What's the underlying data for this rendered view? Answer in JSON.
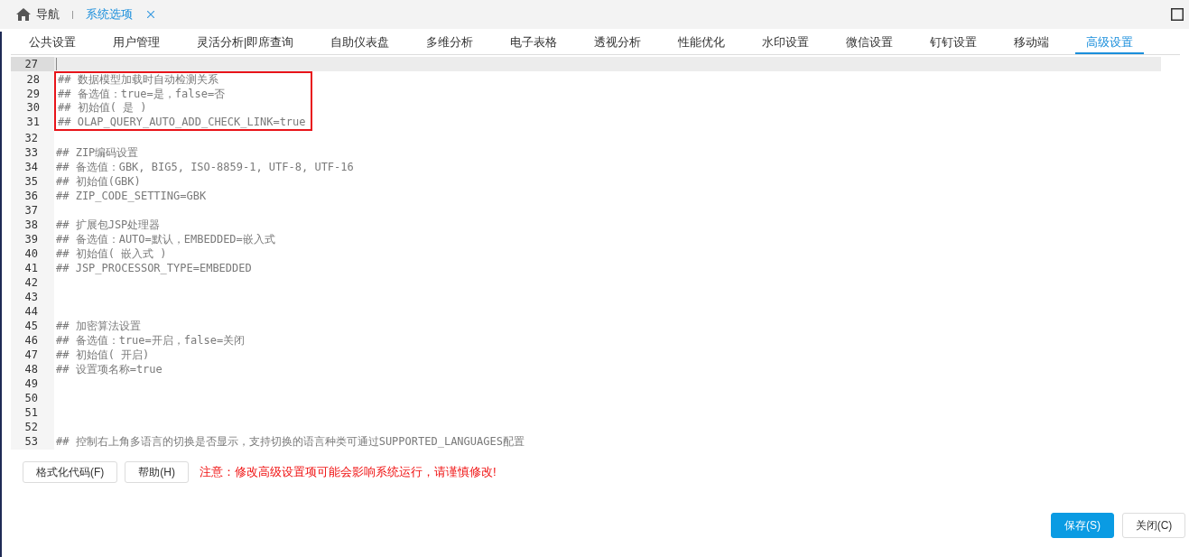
{
  "nav": {
    "home_label": "导航",
    "tabs": [
      {
        "label": "系统选项",
        "selected": true,
        "closable": true
      }
    ]
  },
  "settings_tabs": [
    {
      "label": "公共设置",
      "selected": false
    },
    {
      "label": "用户管理",
      "selected": false
    },
    {
      "label": "灵活分析|即席查询",
      "selected": false
    },
    {
      "label": "自助仪表盘",
      "selected": false
    },
    {
      "label": "多维分析",
      "selected": false
    },
    {
      "label": "电子表格",
      "selected": false
    },
    {
      "label": "透视分析",
      "selected": false
    },
    {
      "label": "性能优化",
      "selected": false
    },
    {
      "label": "水印设置",
      "selected": false
    },
    {
      "label": "微信设置",
      "selected": false
    },
    {
      "label": "钉钉设置",
      "selected": false
    },
    {
      "label": "移动端",
      "selected": false
    },
    {
      "label": "高级设置",
      "selected": true
    }
  ],
  "editor": {
    "lines": [
      {
        "number": "27",
        "current": true,
        "boxed": false
      },
      {
        "number": "28",
        "text": "## 数据模型加载时自动检测关系",
        "current": false,
        "boxed": true
      },
      {
        "number": "29",
        "text": "## 备选值：true=是，false=否",
        "current": false,
        "boxed": true
      },
      {
        "number": "30",
        "text": "## 初始值( 是 )",
        "current": false,
        "boxed": true
      },
      {
        "number": "31",
        "text": "## OLAP_QUERY_AUTO_ADD_CHECK_LINK=true",
        "current": false,
        "boxed": true
      },
      {
        "number": "32",
        "current": false,
        "boxed": false
      },
      {
        "number": "33",
        "text": "## ZIP编码设置",
        "current": false,
        "boxed": false
      },
      {
        "number": "34",
        "text": "## 备选值：GBK, BIG5, ISO-8859-1, UTF-8, UTF-16",
        "current": false,
        "boxed": false
      },
      {
        "number": "35",
        "text": "## 初始值(GBK)",
        "current": false,
        "boxed": false
      },
      {
        "number": "36",
        "text": "## ZIP_CODE_SETTING=GBK",
        "current": false,
        "boxed": false
      },
      {
        "number": "37",
        "current": false,
        "boxed": false
      },
      {
        "number": "38",
        "text": "## 扩展包JSP处理器",
        "current": false,
        "boxed": false
      },
      {
        "number": "39",
        "text": "## 备选值：AUTO=默认，EMBEDDED=嵌入式",
        "current": false,
        "boxed": false
      },
      {
        "number": "40",
        "text": "## 初始值( 嵌入式 )",
        "current": false,
        "boxed": false
      },
      {
        "number": "41",
        "text": "## JSP_PROCESSOR_TYPE=EMBEDDED",
        "current": false,
        "boxed": false
      },
      {
        "number": "42",
        "current": false,
        "boxed": false
      },
      {
        "number": "43",
        "current": false,
        "boxed": false
      },
      {
        "number": "44",
        "current": false,
        "boxed": false
      },
      {
        "number": "45",
        "text": "## 加密算法设置",
        "current": false,
        "boxed": false
      },
      {
        "number": "46",
        "text": "## 备选值：true=开启，false=关闭",
        "current": false,
        "boxed": false
      },
      {
        "number": "47",
        "text": "## 初始值( 开启)",
        "current": false,
        "boxed": false
      },
      {
        "number": "48",
        "text": "## 设置项名称=true",
        "current": false,
        "boxed": false
      },
      {
        "number": "49",
        "current": false,
        "boxed": false
      },
      {
        "number": "50",
        "current": false,
        "boxed": false
      },
      {
        "number": "51",
        "current": false,
        "boxed": false
      },
      {
        "number": "52",
        "current": false,
        "boxed": false
      },
      {
        "number": "53",
        "text": "## 控制右上角多语言的切换是否显示，支持切换的语言种类可通过SUPPORTED_LANGUAGES配置",
        "current": false,
        "boxed": false
      }
    ]
  },
  "tool_buttons": [
    "格式化代码(F)",
    "帮助(H)"
  ],
  "warning": "注意：修改高级设置项可能会影响系统运行，请谨慎修改!",
  "actions": [
    {
      "label": "保存(S)",
      "kind": "primary"
    },
    {
      "label": "关闭(C)",
      "kind": "default"
    }
  ]
}
